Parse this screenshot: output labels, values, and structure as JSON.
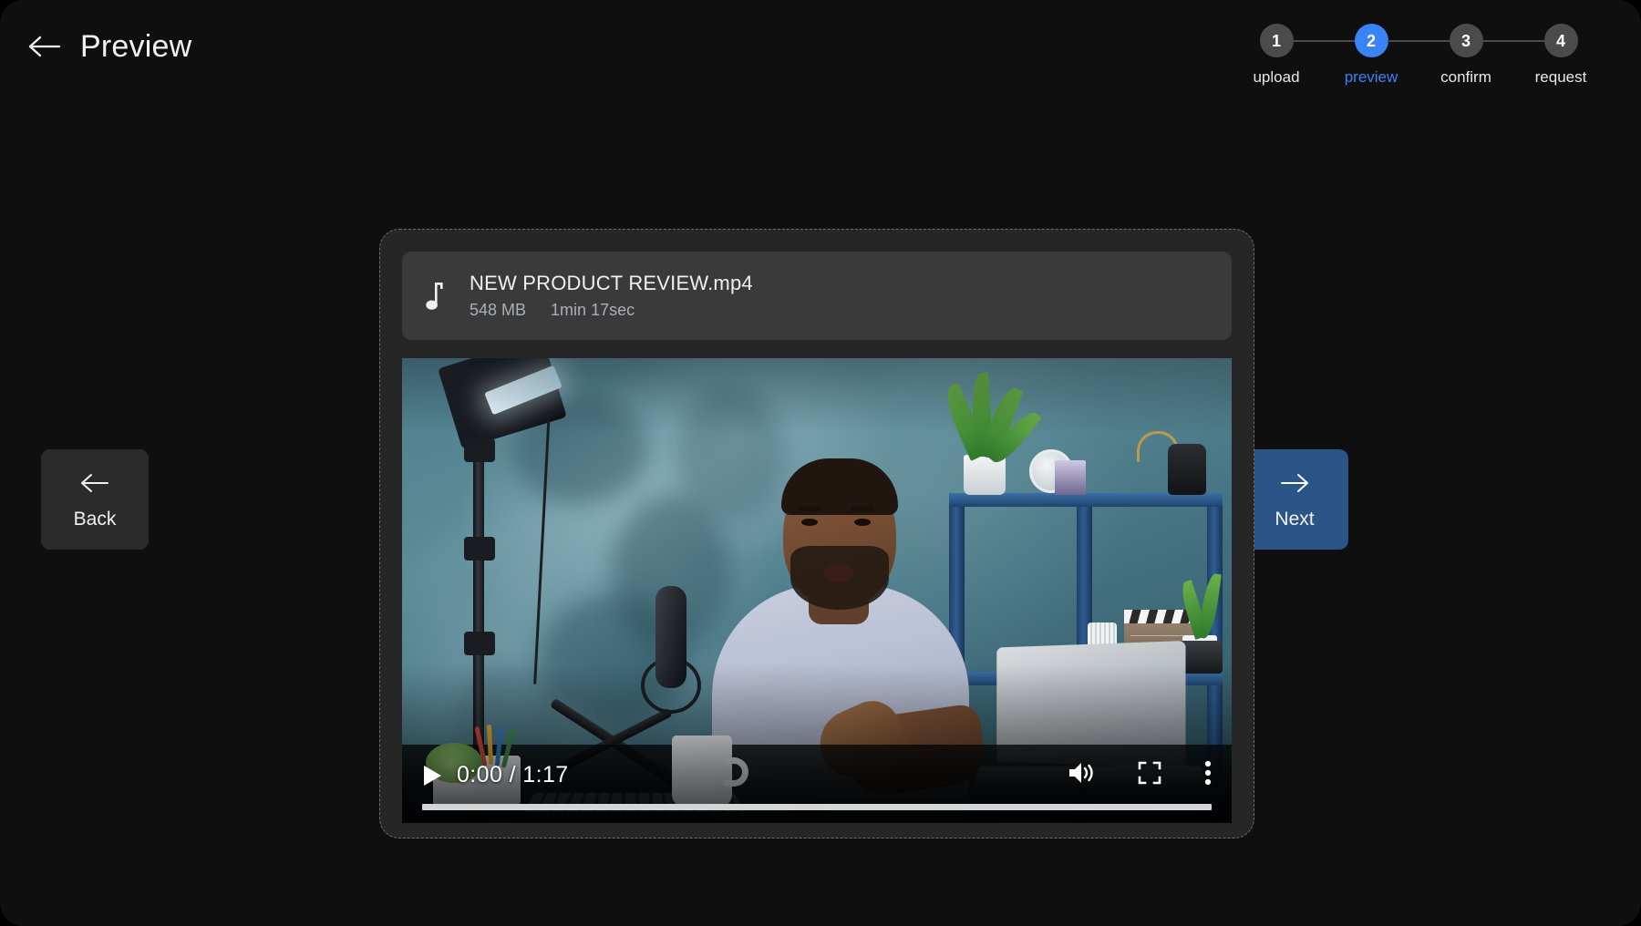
{
  "header": {
    "title": "Preview",
    "back_icon": "arrow-left-icon"
  },
  "stepper": {
    "active_color": "#3b82f6",
    "inactive_color": "#4b4b4b",
    "steps": [
      {
        "number": "1",
        "label": "upload",
        "active": false
      },
      {
        "number": "2",
        "label": "preview",
        "active": true
      },
      {
        "number": "3",
        "label": "confirm",
        "active": false
      },
      {
        "number": "4",
        "label": "request",
        "active": false
      }
    ]
  },
  "file": {
    "icon": "music-note-icon",
    "name": "NEW PRODUCT REVIEW.mp4",
    "size": "548 MB",
    "duration": "1min 17sec"
  },
  "video": {
    "play_icon": "play-icon",
    "current_time": "0:00",
    "separator": "/",
    "total_time": "1:17",
    "time_display": "0:00 / 1:17",
    "volume_icon": "volume-high-icon",
    "fullscreen_icon": "fullscreen-icon",
    "more_icon": "more-vertical-icon",
    "progress_percent": 0
  },
  "actions": {
    "back": {
      "label": "Back",
      "icon": "arrow-left-icon"
    },
    "next": {
      "label": "Next",
      "icon": "arrow-right-icon",
      "color": "#2b5586"
    }
  }
}
